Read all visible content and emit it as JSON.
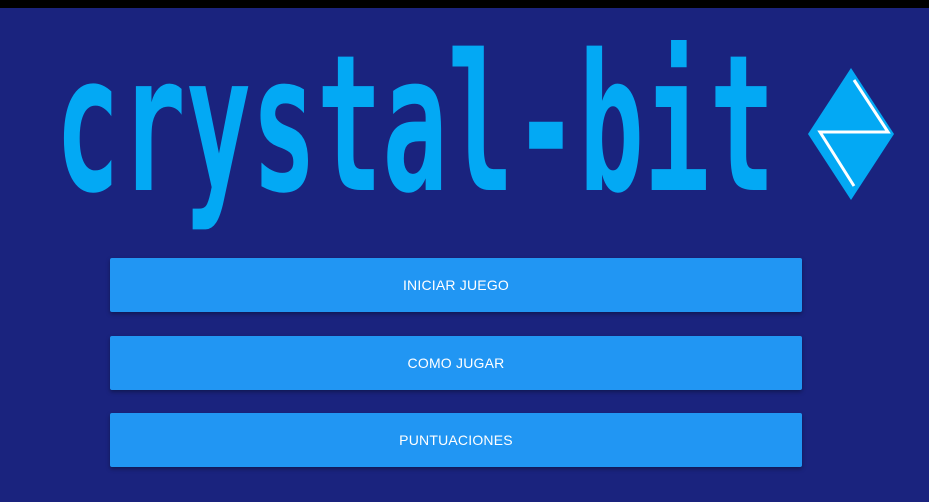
{
  "logo": {
    "text": "crystal-bit",
    "icon": "crystal-diamond-icon",
    "color": "#03a9f4"
  },
  "menu": {
    "start_label": "INICIAR JUEGO",
    "how_to_play_label": "COMO JUGAR",
    "scores_label": "PUNTUACIONES"
  },
  "colors": {
    "background": "#1a237e",
    "button": "#2196f3",
    "accent": "#03a9f4"
  }
}
